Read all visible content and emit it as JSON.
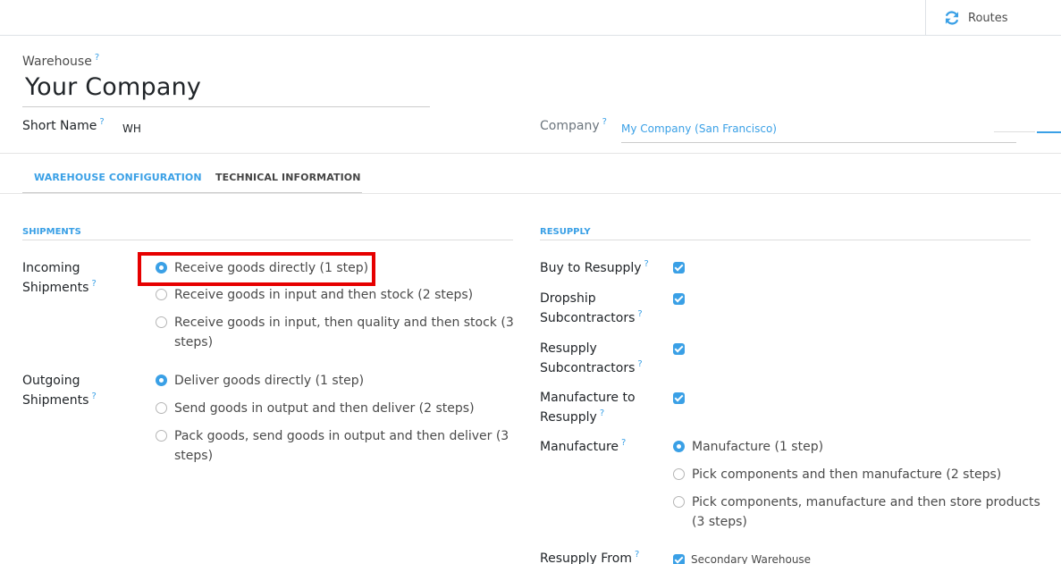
{
  "topbar": {
    "routes_label": "Routes"
  },
  "form": {
    "warehouse_label": "Warehouse",
    "warehouse_name": "Your Company",
    "short_name_label": "Short Name",
    "short_name_value": "WH",
    "company_label": "Company",
    "company_value": "My Company (San Francisco)",
    "help_mark": "?"
  },
  "tabs": [
    {
      "label": "WAREHOUSE CONFIGURATION",
      "active": true
    },
    {
      "label": "TECHNICAL INFORMATION",
      "active": false
    }
  ],
  "shipments": {
    "heading": "SHIPMENTS",
    "incoming": {
      "label_line1": "Incoming",
      "label_line2": "Shipments",
      "options": [
        {
          "text": "Receive goods directly (1 step)",
          "selected": true
        },
        {
          "text": "Receive goods in input and then stock (2 steps)",
          "selected": false
        },
        {
          "text_line1": "Receive goods in input, then quality and then stock (3",
          "text_line2": "steps)",
          "selected": false
        }
      ]
    },
    "outgoing": {
      "label_line1": "Outgoing",
      "label_line2": "Shipments",
      "options": [
        {
          "text": "Deliver goods directly (1 step)",
          "selected": true
        },
        {
          "text": "Send goods in output and then deliver (2 steps)",
          "selected": false
        },
        {
          "text_line1": "Pack goods, send goods in output and then deliver (3",
          "text_line2": "steps)",
          "selected": false
        }
      ]
    }
  },
  "resupply": {
    "heading": "RESUPPLY",
    "buy": {
      "label": "Buy to Resupply",
      "checked": true
    },
    "dropship": {
      "label_line1": "Dropship",
      "label_line2": "Subcontractors",
      "checked": true
    },
    "resupply_sub": {
      "label_line1": "Resupply",
      "label_line2": "Subcontractors",
      "checked": true
    },
    "manufacture_to": {
      "label_line1": "Manufacture to",
      "label_line2": "Resupply",
      "checked": true
    },
    "manufacture": {
      "label": "Manufacture",
      "options": [
        {
          "text": "Manufacture (1 step)",
          "selected": true
        },
        {
          "text": "Pick components and then manufacture (2 steps)",
          "selected": false
        },
        {
          "text_line1": "Pick components, manufacture and then store products",
          "text_line2": "(3 steps)",
          "selected": false
        }
      ]
    },
    "resupply_from": {
      "label": "Resupply From",
      "option": "Secondary Warehouse",
      "checked": true
    }
  },
  "colors": {
    "accent": "#3aa0e6",
    "highlight": "#e60000"
  }
}
